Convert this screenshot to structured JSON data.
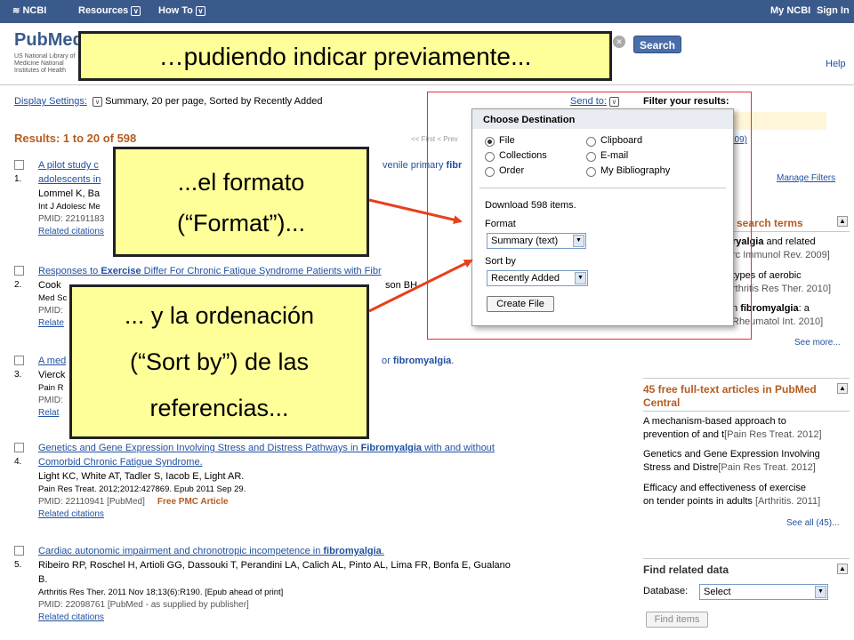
{
  "topbar": {
    "ncbi": "NCBI",
    "resources": "Resources",
    "howto": "How To",
    "myncbi": "My NCBI",
    "signin": "Sign In"
  },
  "header": {
    "logo": "PubMed",
    "subtitle": "US National Library of Medicine National Institutes of Health",
    "search_button": "Search",
    "help": "Help"
  },
  "display": {
    "label": "Display Settings:",
    "value": "Summary, 20 per page, Sorted by Recently Added",
    "results": "Results: 1 to 20 of 598",
    "pager": "<< First  < Prev"
  },
  "results": [
    {
      "num": "1.",
      "title_a": "A pilot study c",
      "title_b": "venile primary fibr",
      "title_c": "adolescents in",
      "authors": "Lommel K, Ba",
      "journal": "Int J Adolesc Me",
      "pmid": "PMID: 22191183",
      "related": "Related citations"
    },
    {
      "num": "2.",
      "title": "Responses to Exercise Differ For Chronic Fatigue Syndrome Patients with Fibr",
      "authors": "Cook",
      "authors_tail": "son BH.",
      "journal": "Med Sc",
      "pmid": "PMID:",
      "related": "Relate"
    },
    {
      "num": "3.",
      "title_a": "A med",
      "title_b": "or fibromyalgia.",
      "authors": "Vierck",
      "journal": "Pain R",
      "pmid": "PMID:",
      "related": "Relat"
    },
    {
      "num": "4.",
      "title_line1": "Genetics and Gene Expression Involving Stress and Distress Pathways in Fibromyalgia with and without",
      "title_line2": "Comorbid Chronic Fatigue Syndrome.",
      "authors": "Light KC, White AT, Tadler S, Iacob E, Light AR.",
      "journal": "Pain Res Treat. 2012;2012:427869. Epub 2011 Sep 29.",
      "pmid": "PMID: 22110941 [PubMed]",
      "free": "Free PMC Article",
      "related": "Related citations"
    },
    {
      "num": "5.",
      "title": "Cardiac autonomic impairment and chronotropic incompetence in fibromyalgia.",
      "authors_line1": "Ribeiro RP, Roschel H, Artioli GG, Dassouki T, Perandini LA, Calich AL, Pinto AL, Lima FR, Bonfa E, Gualano",
      "authors_line2": "B.",
      "journal": "Arthritis Res Ther. 2011 Nov 18;13(6):R190. [Epub ahead of print]",
      "pmid": "PMID: 22098761 [PubMed - as supplied by publisher]",
      "related": "Related citations"
    }
  ],
  "sidebar": {
    "sendto": "Send to:",
    "filter": "Filter your results:",
    "filtercount": "109)",
    "manage": "Manage Filters",
    "search_terms_title": "search terms",
    "search_terms": [
      {
        "a": "ryalgia",
        "b": " and related",
        "c": "rc Immunol Rev. 2009]"
      },
      {
        "a": " types of aerobic",
        "b": "",
        "c": "rthritis Res Ther. 2010]"
      },
      {
        "a": "n ",
        "b": "fibromyalgia",
        "c": ": a",
        "d": "Rheumatol Int. 2010]"
      }
    ],
    "see_more": "See more...",
    "pmc_title": "45 free full-text articles in PubMed Central",
    "pmc_items": [
      {
        "line1": "A mechanism-based approach to",
        "line2": "prevention of and t",
        "meta": "[Pain Res Treat. 2012]"
      },
      {
        "line1": "Genetics and Gene Expression Involving",
        "line2": "Stress and Distre",
        "meta": "[Pain Res Treat. 2012]"
      },
      {
        "line1": "Efficacy and effectiveness of exercise",
        "line2": "on tender points in adults",
        "meta": "[Arthritis. 2011]"
      }
    ],
    "see_all": "See all (45)...",
    "find_title": "Find related data",
    "database_label": "Database:",
    "database_value": "Select",
    "find_items": "Find items"
  },
  "popup": {
    "title": "Choose Destination",
    "options": [
      "File",
      "Clipboard",
      "Collections",
      "E-mail",
      "Order",
      "My Bibliography"
    ],
    "download": "Download 598 items.",
    "format_label": "Format",
    "format_value": "Summary (text)",
    "sort_label": "Sort by",
    "sort_value": "Recently Added",
    "create": "Create File"
  },
  "callouts": {
    "c1": "…pudiendo indicar previamente...",
    "c2_line1": "...el formato",
    "c2_line2": "(“Format”)...",
    "c3_line1": "... y la ordenación",
    "c3_line2": "(“Sort by”) de las",
    "c3_line3": "referencias..."
  },
  "colors": {
    "arrow": "#e8401c",
    "callout_bg": "#ffff99",
    "topbar": "#3a5a8c",
    "results_heading": "#b45c20"
  }
}
